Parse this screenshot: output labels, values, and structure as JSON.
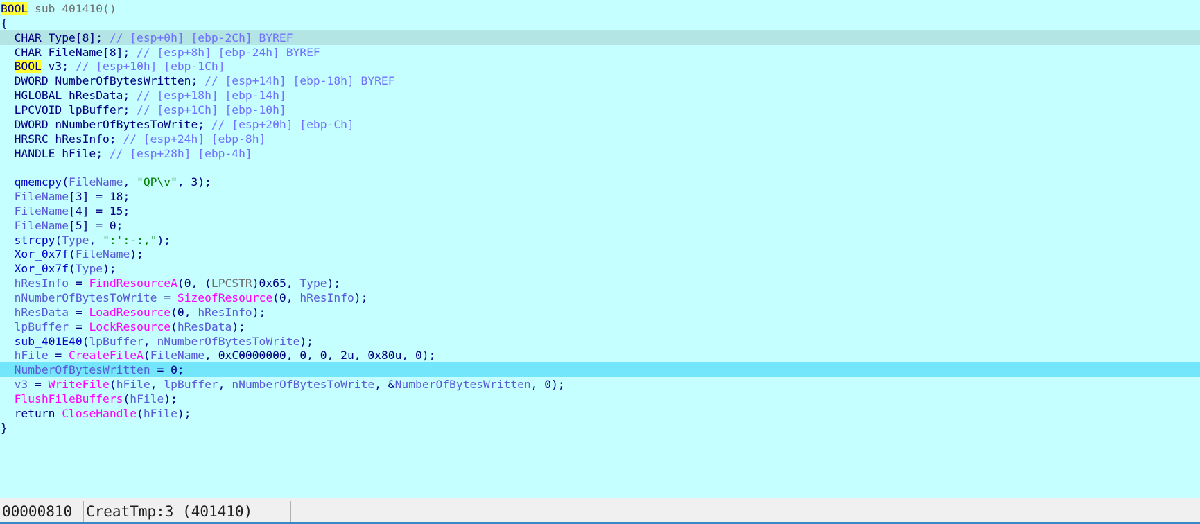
{
  "editor": {
    "lines": [
      [
        [
          "BOOL",
          "yel"
        ],
        [
          " sub_401410()",
          "gry"
        ]
      ],
      [
        [
          "{",
          "p"
        ]
      ],
      [
        [
          "  CHAR Type[8]; ",
          "kw"
        ],
        [
          "// [esp+0h] [ebp-2Ch] BYREF",
          "cm"
        ]
      ],
      [
        [
          "  CHAR FileName[8]; ",
          "kw"
        ],
        [
          "// [esp+8h] [ebp-24h] BYREF",
          "cm"
        ]
      ],
      [
        [
          "  ",
          "kw"
        ],
        [
          "BOOL",
          "yel"
        ],
        [
          " v3; ",
          "kw"
        ],
        [
          "// [esp+10h] [ebp-1Ch]",
          "cm"
        ]
      ],
      [
        [
          "  DWORD NumberOfBytesWritten; ",
          "kw"
        ],
        [
          "// [esp+14h] [ebp-18h] BYREF",
          "cm"
        ]
      ],
      [
        [
          "  HGLOBAL hResData; ",
          "kw"
        ],
        [
          "// [esp+18h] [ebp-14h]",
          "cm"
        ]
      ],
      [
        [
          "  LPCVOID lpBuffer; ",
          "kw"
        ],
        [
          "// [esp+1Ch] [ebp-10h]",
          "cm"
        ]
      ],
      [
        [
          "  DWORD nNumberOfBytesToWrite; ",
          "kw"
        ],
        [
          "// [esp+20h] [ebp-Ch]",
          "cm"
        ]
      ],
      [
        [
          "  HRSRC hResInfo; ",
          "kw"
        ],
        [
          "// [esp+24h] [ebp-8h]",
          "cm"
        ]
      ],
      [
        [
          "  HANDLE hFile; ",
          "kw"
        ],
        [
          "// [esp+28h] [ebp-4h]",
          "cm"
        ]
      ],
      [
        [
          "",
          "p"
        ]
      ],
      [
        [
          "  ",
          "p"
        ],
        [
          "qmemcpy",
          "fn"
        ],
        [
          "(",
          "p"
        ],
        [
          "FileName",
          "var"
        ],
        [
          ", ",
          "p"
        ],
        [
          "\"QP\\v\"",
          "str"
        ],
        [
          ", 3);",
          "p"
        ]
      ],
      [
        [
          "  ",
          "p"
        ],
        [
          "FileName",
          "var"
        ],
        [
          "[3] = 18;",
          "p"
        ]
      ],
      [
        [
          "  ",
          "p"
        ],
        [
          "FileName",
          "var"
        ],
        [
          "[4] = 15;",
          "p"
        ]
      ],
      [
        [
          "  ",
          "p"
        ],
        [
          "FileName",
          "var"
        ],
        [
          "[5] = 0;",
          "p"
        ]
      ],
      [
        [
          "  ",
          "p"
        ],
        [
          "strcpy",
          "fn"
        ],
        [
          "(",
          "p"
        ],
        [
          "Type",
          "var"
        ],
        [
          ", ",
          "p"
        ],
        [
          "\":':-:,\"",
          "str"
        ],
        [
          ");",
          "p"
        ]
      ],
      [
        [
          "  ",
          "p"
        ],
        [
          "Xor_0x7f",
          "fn"
        ],
        [
          "(",
          "p"
        ],
        [
          "FileName",
          "var"
        ],
        [
          ");",
          "p"
        ]
      ],
      [
        [
          "  ",
          "p"
        ],
        [
          "Xor_0x7f",
          "fn"
        ],
        [
          "(",
          "p"
        ],
        [
          "Type",
          "var"
        ],
        [
          ");",
          "p"
        ]
      ],
      [
        [
          "  ",
          "p"
        ],
        [
          "hResInfo",
          "var"
        ],
        [
          " = ",
          "p"
        ],
        [
          "FindResourceA",
          "api"
        ],
        [
          "(0, (",
          "p"
        ],
        [
          "LPCSTR",
          "ty"
        ],
        [
          ")0x65, ",
          "p"
        ],
        [
          "Type",
          "var"
        ],
        [
          ");",
          "p"
        ]
      ],
      [
        [
          "  ",
          "p"
        ],
        [
          "nNumberOfBytesToWrite",
          "var"
        ],
        [
          " = ",
          "p"
        ],
        [
          "SizeofResource",
          "api"
        ],
        [
          "(0, ",
          "p"
        ],
        [
          "hResInfo",
          "var"
        ],
        [
          ");",
          "p"
        ]
      ],
      [
        [
          "  ",
          "p"
        ],
        [
          "hResData",
          "var"
        ],
        [
          " = ",
          "p"
        ],
        [
          "LoadResource",
          "api"
        ],
        [
          "(0, ",
          "p"
        ],
        [
          "hResInfo",
          "var"
        ],
        [
          ");",
          "p"
        ]
      ],
      [
        [
          "  ",
          "p"
        ],
        [
          "lpBuffer",
          "var"
        ],
        [
          " = ",
          "p"
        ],
        [
          "LockResource",
          "api"
        ],
        [
          "(",
          "p"
        ],
        [
          "hResData",
          "var"
        ],
        [
          ");",
          "p"
        ]
      ],
      [
        [
          "  ",
          "p"
        ],
        [
          "sub_401E40",
          "fn"
        ],
        [
          "(",
          "p"
        ],
        [
          "lpBuffer",
          "var"
        ],
        [
          ", ",
          "p"
        ],
        [
          "nNumberOfBytesToWrite",
          "var"
        ],
        [
          ");",
          "p"
        ]
      ],
      [
        [
          "  ",
          "p"
        ],
        [
          "hFile",
          "var"
        ],
        [
          " = ",
          "p"
        ],
        [
          "CreateFileA",
          "api"
        ],
        [
          "(",
          "p"
        ],
        [
          "FileName",
          "var"
        ],
        [
          ", 0xC0000000, 0, 0, 2u, 0x80u, 0);",
          "p"
        ]
      ],
      [
        [
          "  ",
          "p"
        ],
        [
          "NumberOfBytesWritten",
          "var"
        ],
        [
          " = 0;",
          "p"
        ]
      ],
      [
        [
          "  ",
          "p"
        ],
        [
          "v3",
          "var"
        ],
        [
          " = ",
          "p"
        ],
        [
          "WriteFile",
          "api"
        ],
        [
          "(",
          "p"
        ],
        [
          "hFile",
          "var"
        ],
        [
          ", ",
          "p"
        ],
        [
          "lpBuffer",
          "var"
        ],
        [
          ", ",
          "p"
        ],
        [
          "nNumberOfBytesToWrite",
          "var"
        ],
        [
          ", &",
          "p"
        ],
        [
          "NumberOfBytesWritten",
          "var"
        ],
        [
          ", 0);",
          "p"
        ]
      ],
      [
        [
          "  ",
          "p"
        ],
        [
          "FlushFileBuffers",
          "api"
        ],
        [
          "(",
          "p"
        ],
        [
          "hFile",
          "var"
        ],
        [
          ");",
          "p"
        ]
      ],
      [
        [
          "  return ",
          "kw"
        ],
        [
          "CloseHandle",
          "api"
        ],
        [
          "(",
          "p"
        ],
        [
          "hFile",
          "var"
        ],
        [
          ");",
          "p"
        ]
      ],
      [
        [
          "}",
          "p"
        ]
      ]
    ],
    "highlighted_lines": {
      "gray": 2,
      "cyan": 25
    }
  },
  "statusbar": {
    "address": "00000810",
    "location": "CreatTmp:3 (401410)"
  },
  "colors": {
    "background": "#c5ffff",
    "line_highlight_gray": "#b3e5e5",
    "line_highlight_cyan": "#74e6fb",
    "keyword_highlight": "#ffff33",
    "comment": "#7070ff",
    "variable": "#5a5ad6",
    "api_call": "#ff00ff",
    "string": "#008000"
  }
}
